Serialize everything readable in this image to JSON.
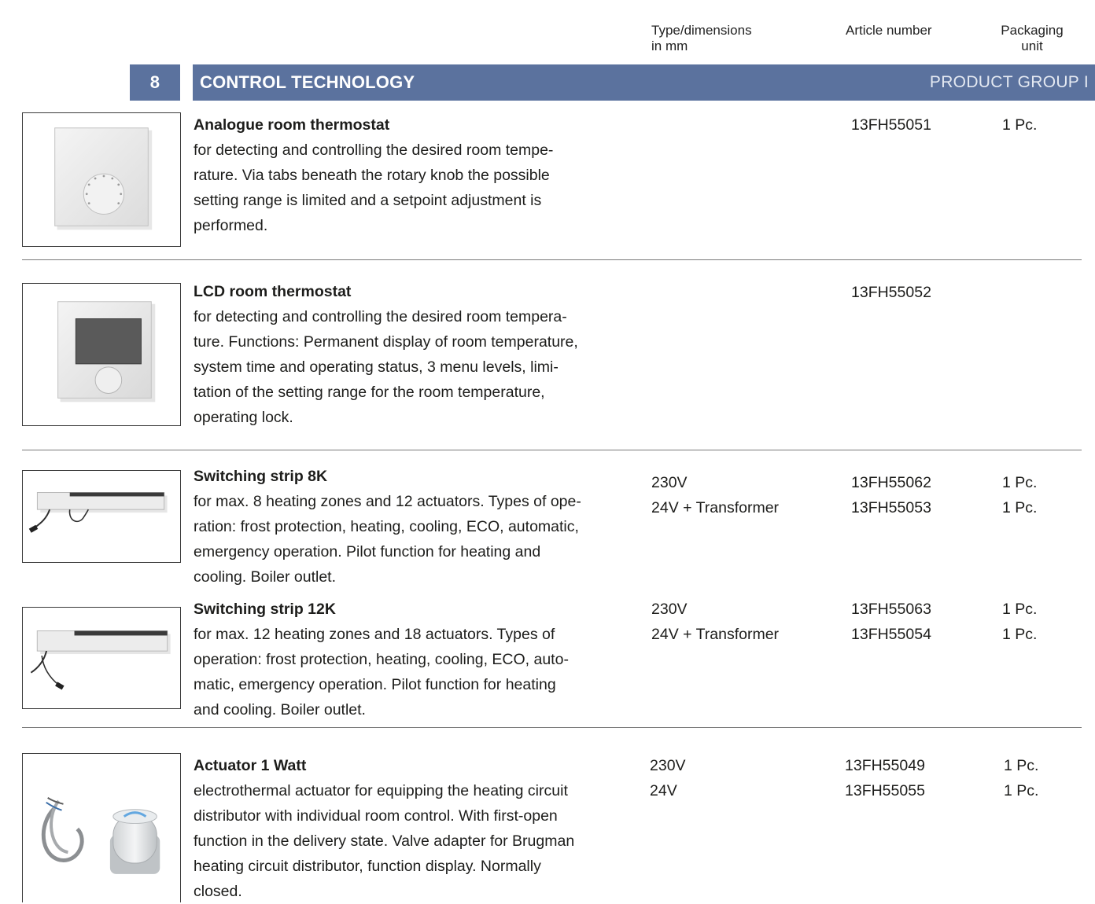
{
  "columns": {
    "type_line1": "Type/dimensions",
    "type_line2": "in mm",
    "article": "Article number",
    "pack_line1": "Packaging",
    "pack_line2": "unit"
  },
  "section": {
    "number": "8",
    "title": "CONTROL TECHNOLOGY",
    "group": "PRODUCT GROUP I",
    "color": "#5b729e"
  },
  "products": [
    {
      "title": "Analogue room thermostat",
      "desc": [
        "for detecting and controlling the desired room tempe-",
        "rature. Via tabs beneath the rotary knob the possible",
        "setting range is limited and a setpoint adjustment is",
        "performed."
      ],
      "types": [],
      "articles": [
        "13FH55051"
      ],
      "packs": [
        "1 Pc."
      ]
    },
    {
      "title": "LCD room thermostat",
      "desc": [
        "for detecting and controlling the desired room tempera-",
        "ture. Functions: Permanent display of room temperature,",
        "system time and operating status, 3 menu levels, limi-",
        "tation of the setting range for the room temperature,",
        "operating lock."
      ],
      "types": [],
      "articles": [
        "13FH55052"
      ],
      "packs": []
    },
    {
      "title": "Switching strip 8K",
      "desc": [
        "for max. 8 heating zones and 12 actuators. Types of ope-",
        "ration: frost protection, heating, cooling, ECO, automatic,",
        "emergency operation. Pilot function for heating and",
        "cooling. Boiler outlet."
      ],
      "types": [
        "230V",
        "24V + Transformer"
      ],
      "articles": [
        "13FH55062",
        "13FH55053"
      ],
      "packs": [
        "1 Pc.",
        "1 Pc."
      ]
    },
    {
      "title": "Switching strip 12K",
      "desc": [
        "for max. 12 heating zones and 18 actuators. Types of",
        "operation: frost protection, heating, cooling, ECO, auto-",
        "matic, emergency operation. Pilot function for heating",
        "and cooling. Boiler outlet."
      ],
      "types": [
        "230V",
        "24V + Transformer"
      ],
      "articles": [
        "13FH55063",
        "13FH55054"
      ],
      "packs": [
        "1 Pc.",
        "1 Pc."
      ]
    },
    {
      "title": "Actuator 1 Watt",
      "desc": [
        "electrothermal actuator for equipping the heating circuit",
        "distributor with individual room control. With first-open",
        "function in the delivery state. Valve adapter for Brugman",
        "heating circuit distributor, function display. Normally",
        "closed."
      ],
      "types": [
        "230V",
        "24V"
      ],
      "articles": [
        "13FH55049",
        "13FH55055"
      ],
      "packs": [
        "1 Pc.",
        "1 Pc."
      ]
    }
  ]
}
